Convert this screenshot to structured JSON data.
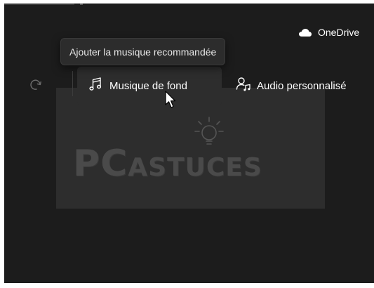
{
  "tooltip": {
    "text": "Ajouter la musique recommandée"
  },
  "cloud": {
    "label": "OneDrive"
  },
  "toolbar": {
    "music_label": "Musique de fond",
    "audio_label": "Audio personnalisé",
    "icons": {
      "redo": "redo-icon",
      "music": "music-note-icon",
      "audio": "custom-audio-icon",
      "cloud": "onedrive-cloud-icon"
    }
  },
  "watermark": {
    "text_big": "PC",
    "text_small": "ASTUCES"
  },
  "colors": {
    "window_bg": "#1c1c1c",
    "button_hover_bg": "#2d2d2d",
    "tooltip_bg": "#2c2c2c",
    "text": "#ffffff"
  }
}
